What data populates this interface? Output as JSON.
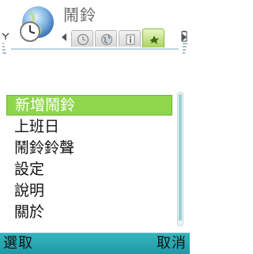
{
  "header": {
    "title": "鬧鈴",
    "app_icon": "clock-globe-icon",
    "tabs": [
      {
        "icon": "clock-icon",
        "active": false
      },
      {
        "icon": "globe-icon",
        "active": false
      },
      {
        "icon": "info-icon",
        "active": false
      },
      {
        "icon": "bird-icon",
        "active": true
      }
    ]
  },
  "menu": {
    "items": [
      {
        "label": "新增鬧鈴",
        "selected": true
      },
      {
        "label": "上班日",
        "selected": false
      },
      {
        "label": "鬧鈴鈴聲",
        "selected": false
      },
      {
        "label": "設定",
        "selected": false
      },
      {
        "label": "說明",
        "selected": false
      },
      {
        "label": "關於",
        "selected": false
      }
    ]
  },
  "softkeys": {
    "left": "選取",
    "right": "取消"
  },
  "colors": {
    "selection": "#8fd64c",
    "softkey_bar": "#1d9aa6",
    "active_tab": "#a8d45a"
  }
}
